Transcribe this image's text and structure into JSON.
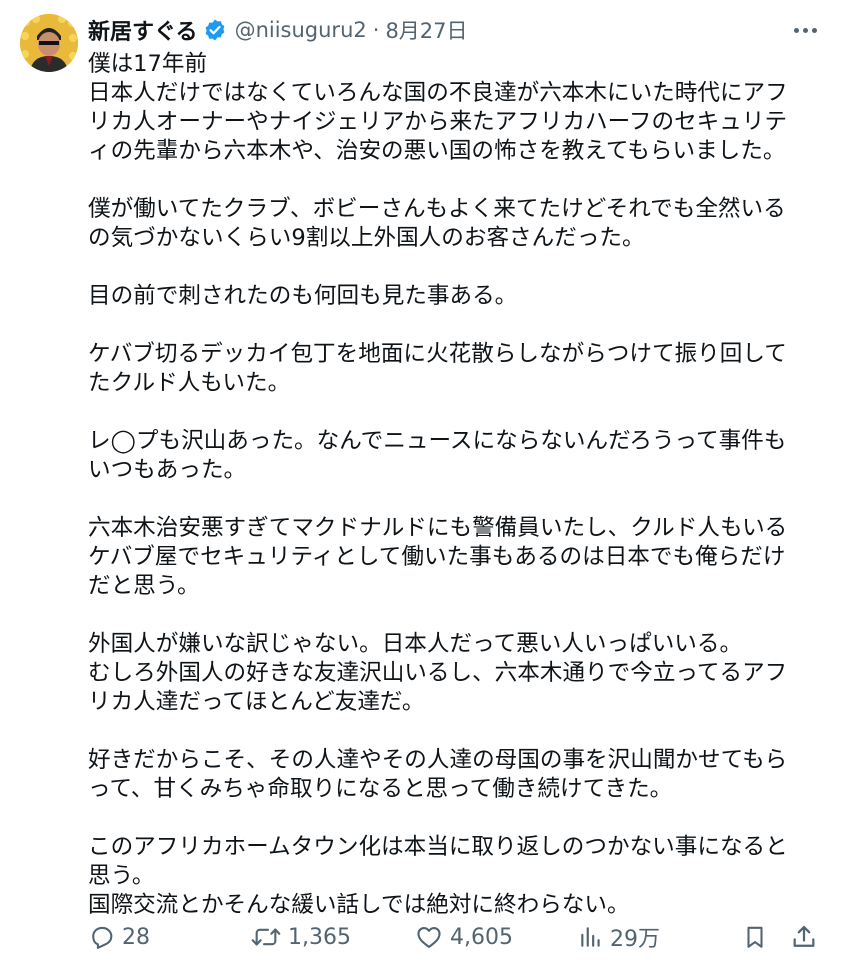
{
  "author": {
    "display_name": "新居すぐる",
    "handle": "@niisuguru2",
    "separator": "·",
    "date": "8月27日",
    "verified_color": "#1d9bf0"
  },
  "tweet": {
    "lines": [
      "僕は17年前",
      "日本人だけではなくていろんな国の不良達が六本木にいた時代にアフ",
      "リカ人オーナーやナイジェリアから来たアフリカハーフのセキュリテ",
      "ィの先輩から六本木や、治安の悪い国の怖さを教えてもらいました。",
      "",
      "僕が働いてたクラブ、ボビーさんもよく来てたけどそれでも全然いる",
      "の気づかないくらい9割以上外国人のお客さんだった。",
      "",
      "目の前で刺されたのも何回も見た事ある。",
      "",
      "ケバブ切るデッカイ包丁を地面に火花散らしながらつけて振り回して",
      "たクルド人もいた。",
      "",
      "レ◯プも沢山あった。なんでニュースにならないんだろうって事件も",
      "いつもあった。",
      "",
      "六本木治安悪すぎてマクドナルドにも警備員いたし、クルド人もいる",
      "ケバブ屋でセキュリティとして働いた事もあるのは日本でも俺らだけ",
      "だと思う。",
      "",
      "外国人が嫌いな訳じゃない。日本人だって悪い人いっぱいいる。",
      "むしろ外国人の好きな友達沢山いるし、六本木通りで今立ってるアフ",
      "リカ人達だってほとんど友達だ。",
      "",
      "好きだからこそ、その人達やその人達の母国の事を沢山聞かせてもら",
      "って、甘くみちゃ命取りになると思って働き続けてきた。",
      "",
      "このアフリカホームタウン化は本当に取り返しのつかない事になると",
      "思う。",
      "国際交流とかそんな緩い話しでは絶対に終わらない。"
    ]
  },
  "actions": {
    "reply_count": "28",
    "retweet_count": "1,365",
    "like_count": "4,605",
    "views_count": "29万",
    "icons": [
      "reply-icon",
      "retweet-icon",
      "like-icon",
      "views-icon",
      "bookmark-icon",
      "share-icon"
    ]
  }
}
